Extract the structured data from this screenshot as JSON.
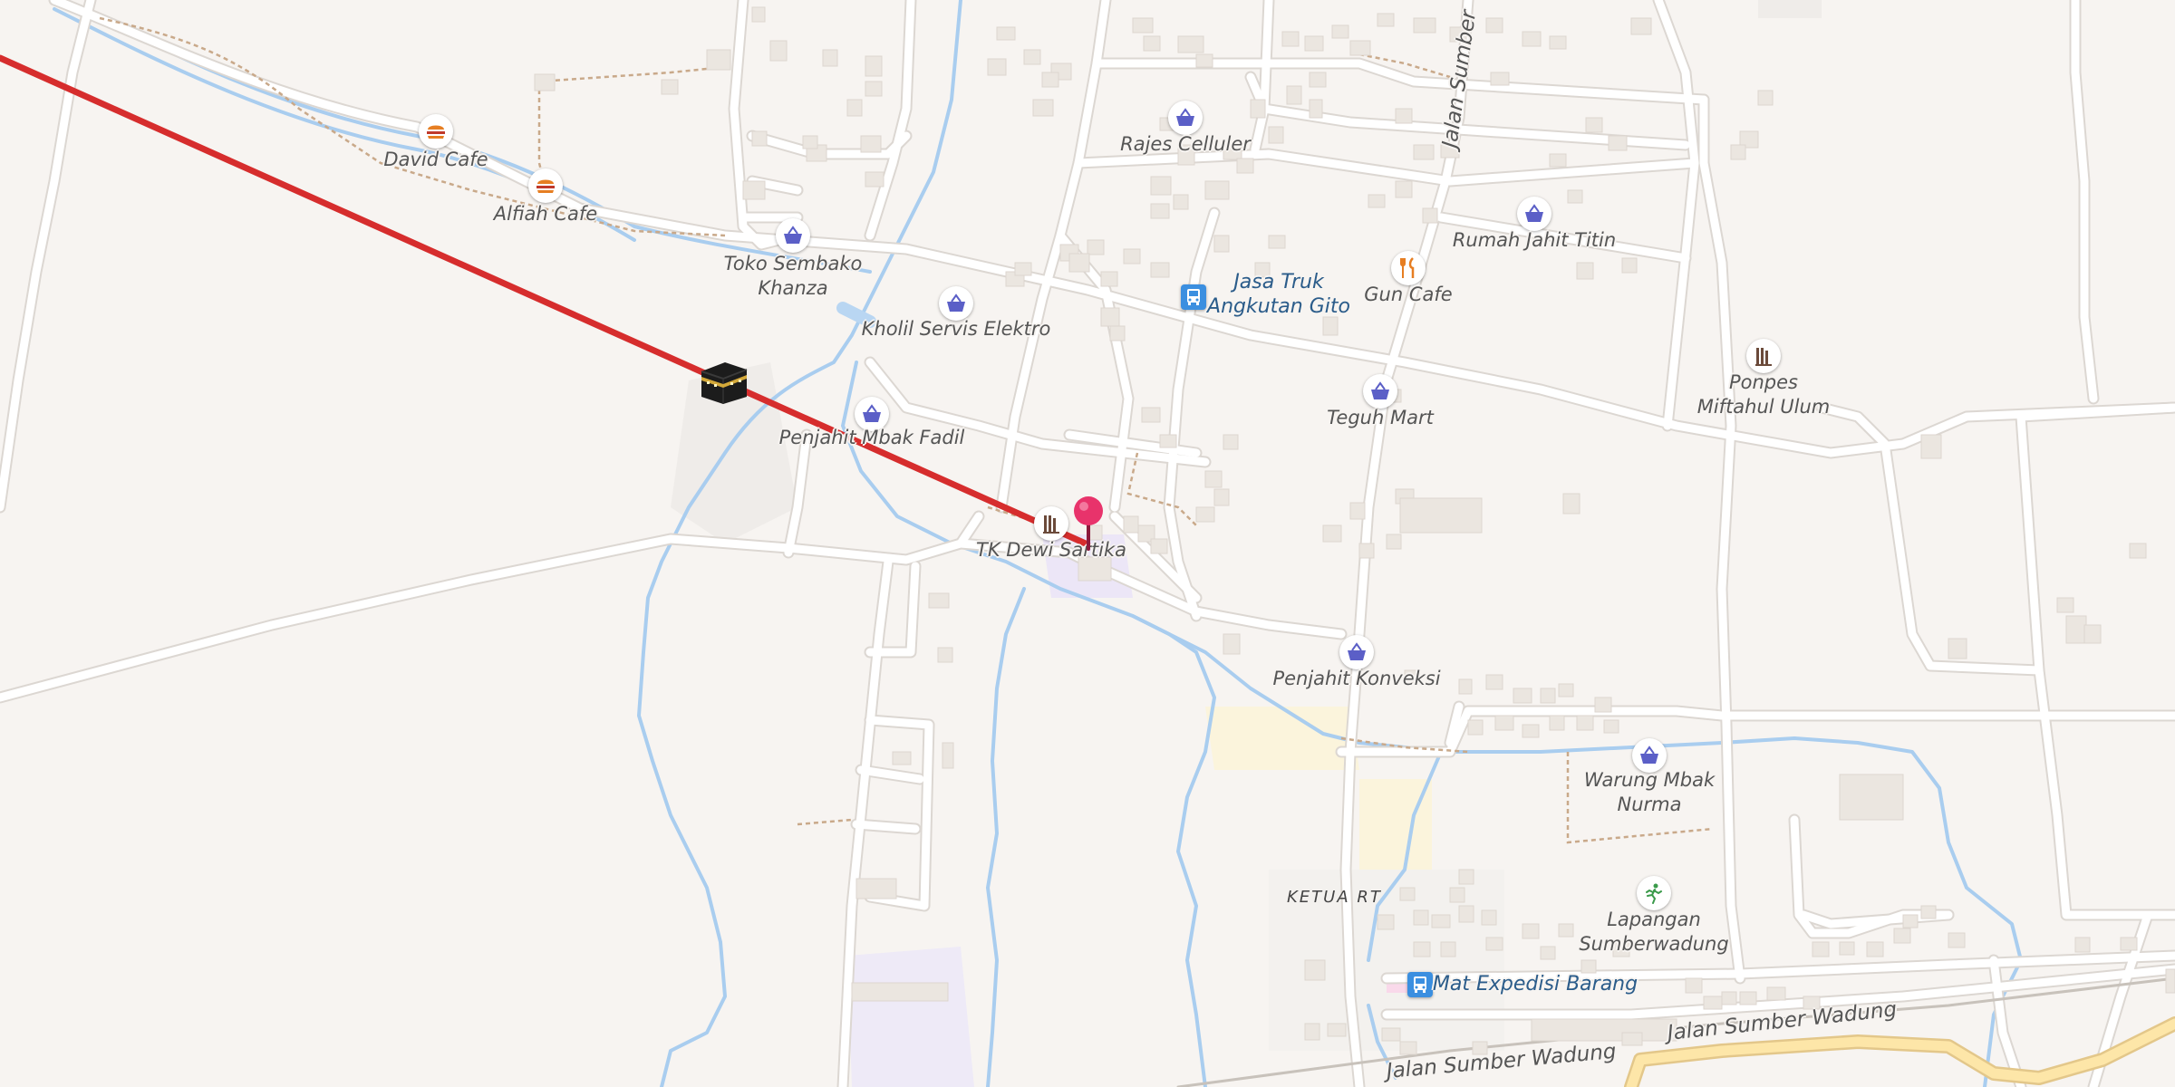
{
  "map": {
    "pois": [
      {
        "id": "david-cafe",
        "name": "David Cafe",
        "category": "fast-food",
        "icon": "burger-icon",
        "color": "#e67e22"
      },
      {
        "id": "alfiah-cafe",
        "name": "Alfiah Cafe",
        "category": "fast-food",
        "icon": "burger-icon",
        "color": "#e67e22"
      },
      {
        "id": "toko-sembako",
        "name": "Toko Sembako\nKhanza",
        "category": "shop",
        "icon": "shopping-basket-icon",
        "color": "#5b5fc7"
      },
      {
        "id": "kholil-servis",
        "name": "Kholil Servis Elektro",
        "category": "shop",
        "icon": "shopping-basket-icon",
        "color": "#5b5fc7"
      },
      {
        "id": "penjahit-fadil",
        "name": "Penjahit Mbak Fadil",
        "category": "shop",
        "icon": "shopping-basket-icon",
        "color": "#5b5fc7"
      },
      {
        "id": "rajes-celluler",
        "name": "Rajes Celluler",
        "category": "shop",
        "icon": "shopping-basket-icon",
        "color": "#5b5fc7"
      },
      {
        "id": "jasa-truk",
        "name": "Jasa Truk\nAngkutan Gito",
        "category": "transport",
        "icon": "bus-icon",
        "color": "#3b8fe0"
      },
      {
        "id": "gun-cafe",
        "name": "Gun Cafe",
        "category": "restaurant",
        "icon": "fork-knife-icon",
        "color": "#e67e22"
      },
      {
        "id": "rumah-jahit",
        "name": "Rumah Jahit Titin",
        "category": "shop",
        "icon": "shopping-basket-icon",
        "color": "#5b5fc7"
      },
      {
        "id": "teguh-mart",
        "name": "Teguh Mart",
        "category": "shop",
        "icon": "shopping-basket-icon",
        "color": "#5b5fc7"
      },
      {
        "id": "ponpes",
        "name": "Ponpes\nMiftahul Ulum",
        "category": "school",
        "icon": "school-icon",
        "color": "#6b4a3a"
      },
      {
        "id": "tk-dewi",
        "name": "TK Dewi Sartika",
        "category": "school",
        "icon": "school-icon",
        "color": "#6b4a3a"
      },
      {
        "id": "penjahit-konveksi",
        "name": "Penjahit Konveksi",
        "category": "shop",
        "icon": "shopping-basket-icon",
        "color": "#5b5fc7"
      },
      {
        "id": "warung-nurma",
        "name": "Warung Mbak\nNurma",
        "category": "shop",
        "icon": "shopping-basket-icon",
        "color": "#5b5fc7"
      },
      {
        "id": "lapangan",
        "name": "Lapangan\nSumberwadung",
        "category": "sport",
        "icon": "running-person-icon",
        "color": "#3a9a4a"
      },
      {
        "id": "mat-expedisi",
        "name": "Mat Expedisi Barang",
        "category": "transport",
        "icon": "bus-icon",
        "color": "#3b8fe0"
      }
    ],
    "area_label": "KETUA RT",
    "roads": [
      {
        "id": "jalan-sumber-vertical",
        "name": "Jalan Sumber"
      },
      {
        "id": "jalan-sumber-wadung-1",
        "name": "Jalan Sumber Wadung"
      },
      {
        "id": "jalan-sumber-wadung-2",
        "name": "Jalan Sumber Wadung"
      }
    ],
    "qibla_line": {
      "color": "#d62d2d",
      "marker_icon": "kaaba-icon"
    },
    "location_pin": {
      "color": "#e8336b",
      "icon": "location-pin-icon"
    }
  }
}
